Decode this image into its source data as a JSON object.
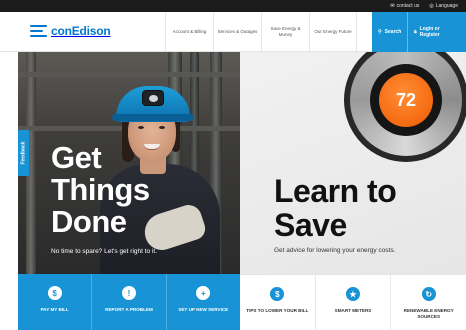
{
  "utility_bar": {
    "contact": "contact us",
    "language": "Language"
  },
  "header": {
    "logo_text": "conEdison",
    "nav": [
      {
        "label": "Account & Billing"
      },
      {
        "label": "Services & Outages"
      },
      {
        "label": "Save Energy & Money"
      },
      {
        "label": "Our Energy Future"
      }
    ],
    "search_label": "Search",
    "login_label": "Login or Register"
  },
  "hero_left": {
    "headline_line1": "Get",
    "headline_line2": "Things",
    "headline_line3": "Done",
    "subtext": "No time to spare? Let's get right to it.",
    "feedback_tab": "Feedback"
  },
  "hero_right": {
    "thermostat_value": "72",
    "headline_line1": "Learn to",
    "headline_line2": "Save",
    "subtext": "Get advice for lowering your energy costs."
  },
  "quick_actions_left": [
    {
      "label": "PAY MY BILL",
      "icon": "pay-bill-icon"
    },
    {
      "label": "REPORT A PROBLEM",
      "icon": "report-problem-icon"
    },
    {
      "label": "SET UP NEW SERVICE",
      "icon": "plus-icon"
    }
  ],
  "quick_actions_right": [
    {
      "label": "TIPS TO LOWER YOUR BILL",
      "icon": "tips-icon"
    },
    {
      "label": "SMART METERS",
      "icon": "smart-meter-icon"
    },
    {
      "label": "RENEWABLE ENERGY SOURCES",
      "icon": "renewable-icon"
    }
  ],
  "colors": {
    "brand_blue": "#0078cf",
    "accent_blue": "#1894d6",
    "thermostat_orange": "#f56a10",
    "topbar": "#1b1b1b"
  }
}
